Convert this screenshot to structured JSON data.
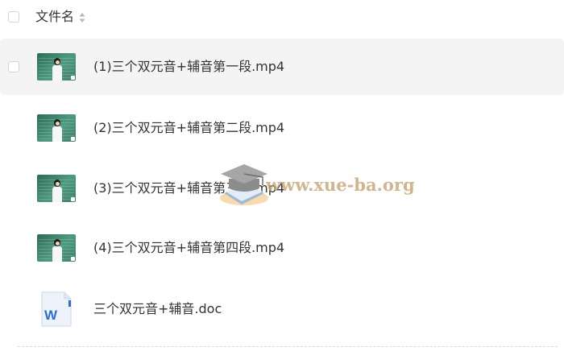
{
  "header": {
    "column_label": "文件名"
  },
  "files": [
    {
      "name": "(1)三个双元音+辅音第一段.mp4",
      "type": "video"
    },
    {
      "name": "(2)三个双元音+辅音第二段.mp4",
      "type": "video"
    },
    {
      "name": "(3)三个双元音+辅音第三段.mp4",
      "type": "video"
    },
    {
      "name": "(4)三个双元音+辅音第四段.mp4",
      "type": "video"
    },
    {
      "name": "三个双元音+辅音.doc",
      "type": "word-document"
    }
  ],
  "doc_icon_letter": "W",
  "watermark": {
    "text": "www.xue-ba.org",
    "icon": "graduation-cap-book-icon"
  },
  "colors": {
    "hover_row": "#f4f4f4",
    "word_blue": "#2b6fd6",
    "watermark": "#c4a06e"
  }
}
